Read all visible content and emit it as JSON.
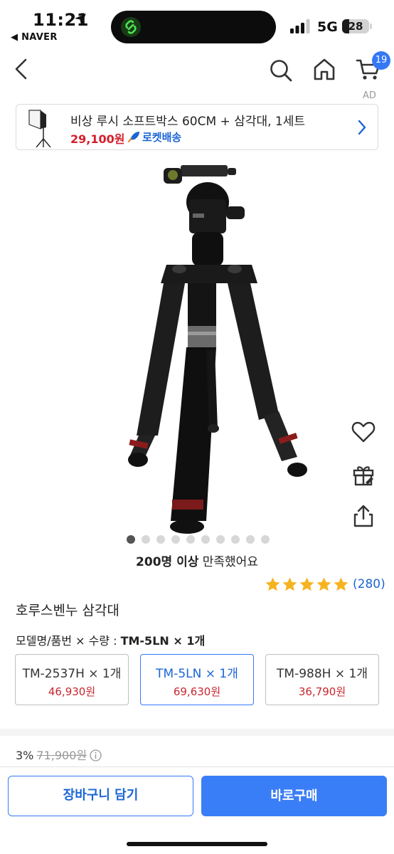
{
  "status_bar": {
    "time": "11:21",
    "back_app": "◀ NAVER",
    "network": "5G",
    "battery": "28"
  },
  "nav": {
    "cart_count": "19",
    "ad_label": "AD",
    "icons": [
      "back-chevron-icon",
      "search-icon",
      "home-icon",
      "cart-icon"
    ]
  },
  "ad_banner": {
    "title": "비상 루시 소프트박스 60CM + 삼각대, 1세트",
    "price": "29,100원",
    "delivery": "로켓배송"
  },
  "product": {
    "gallery_dot_count": 10,
    "gallery_active_index": 0,
    "satisfy_bold": "200명 이상",
    "satisfy_rest": " 만족했어요",
    "rating_stars": 5,
    "review_count": "(280)",
    "name": "호루스벤누 삼각대",
    "option_label": "모델명/품번 × 수량 : ",
    "option_selected": "TM-5LN × 1개",
    "options": [
      {
        "name": "TM-2537H × 1개",
        "price": "46,930원",
        "selected": false
      },
      {
        "name": "TM-5LN × 1개",
        "price": "69,630원",
        "selected": true
      },
      {
        "name": "TM-988H × 1개",
        "price": "36,790원",
        "selected": false
      }
    ],
    "discount_rate": "3%",
    "original_price": "71,900원"
  },
  "actions": {
    "cart_button": "장바구니 담기",
    "buy_button": "바로구매"
  },
  "colors": {
    "accent": "#3478f6",
    "price_red": "#c8262f",
    "star": "#f6b321"
  }
}
